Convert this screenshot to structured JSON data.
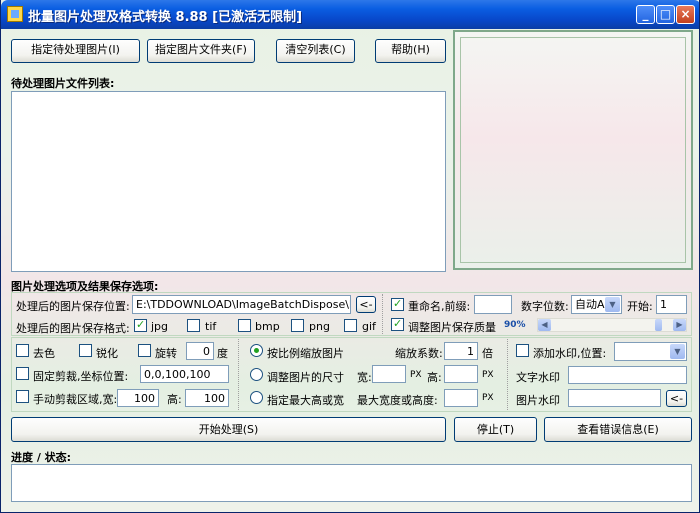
{
  "window": {
    "title": "批量图片处理及格式转换 8.88  [已激活无限制]",
    "controls": [
      "_",
      "□",
      "×"
    ]
  },
  "toolbar": {
    "select_images": "指定待处理图片(I)",
    "select_folder": "指定图片文件夹(F)",
    "clear_list": "清空列表(C)",
    "help": "帮助(H)"
  },
  "file_list": {
    "heading": "待处理图片文件列表:"
  },
  "options": {
    "heading": "图片处理选项及结果保存选项:",
    "save_location_label": "处理后的图片保存位置:",
    "save_location_value": "E:\\TDDOWNLOAD\\ImageBatchDispose\\Im",
    "browse_button": "<-",
    "save_format_label": "处理后的图片保存格式:",
    "formats": [
      {
        "label": "jpg",
        "checked": true
      },
      {
        "label": "tif",
        "checked": false
      },
      {
        "label": "bmp",
        "checked": false
      },
      {
        "label": "png",
        "checked": false
      },
      {
        "label": "gif",
        "checked": false
      }
    ],
    "rename": {
      "label": "重命名,前缀:",
      "checked": true,
      "prefix": ""
    },
    "digits": {
      "label": "数字位数:",
      "value": "自动A"
    },
    "start": {
      "label": "开始:",
      "value": "1"
    },
    "quality": {
      "label": "调整图片保存质量",
      "checked": true,
      "value": "90%",
      "fraction": 0.9
    }
  },
  "effects": {
    "decolor": {
      "label": "去色",
      "checked": false
    },
    "sharpen": {
      "label": "锐化",
      "checked": false
    },
    "rotate": {
      "label": "旋转",
      "checked": false,
      "value": "0",
      "unit": "度"
    },
    "fixed_crop": {
      "label": "固定剪裁,坐标位置:",
      "checked": false,
      "value": "0,0,100,100"
    },
    "manual_crop": {
      "label": "手动剪裁区域,宽:",
      "checked": false,
      "width": "100",
      "height_label": "高:",
      "height": "100"
    }
  },
  "scaling": {
    "by_ratio": {
      "label": "按比例缩放图片",
      "checked": true
    },
    "ratio_label": "缩放系数:",
    "ratio_value": "1",
    "ratio_unit": "倍",
    "by_size": {
      "label": "调整图片的尺寸",
      "checked": false
    },
    "width_label": "宽:",
    "width_unit": "PX",
    "height_label": "高:",
    "height_unit": "PX",
    "by_max": {
      "label": "指定最大高或宽",
      "checked": false
    },
    "max_label": "最大宽度或高度:",
    "max_unit": "PX"
  },
  "watermark": {
    "add": {
      "label": "添加水印,位置:",
      "checked": false
    },
    "text_label": "文字水印",
    "image_label": "图片水印",
    "browse_button": "<-"
  },
  "actions": {
    "start": "开始处理(S)",
    "stop": "停止(T)",
    "view_errors": "查看错误信息(E)"
  },
  "progress": {
    "label": "进度 / 状态:"
  }
}
